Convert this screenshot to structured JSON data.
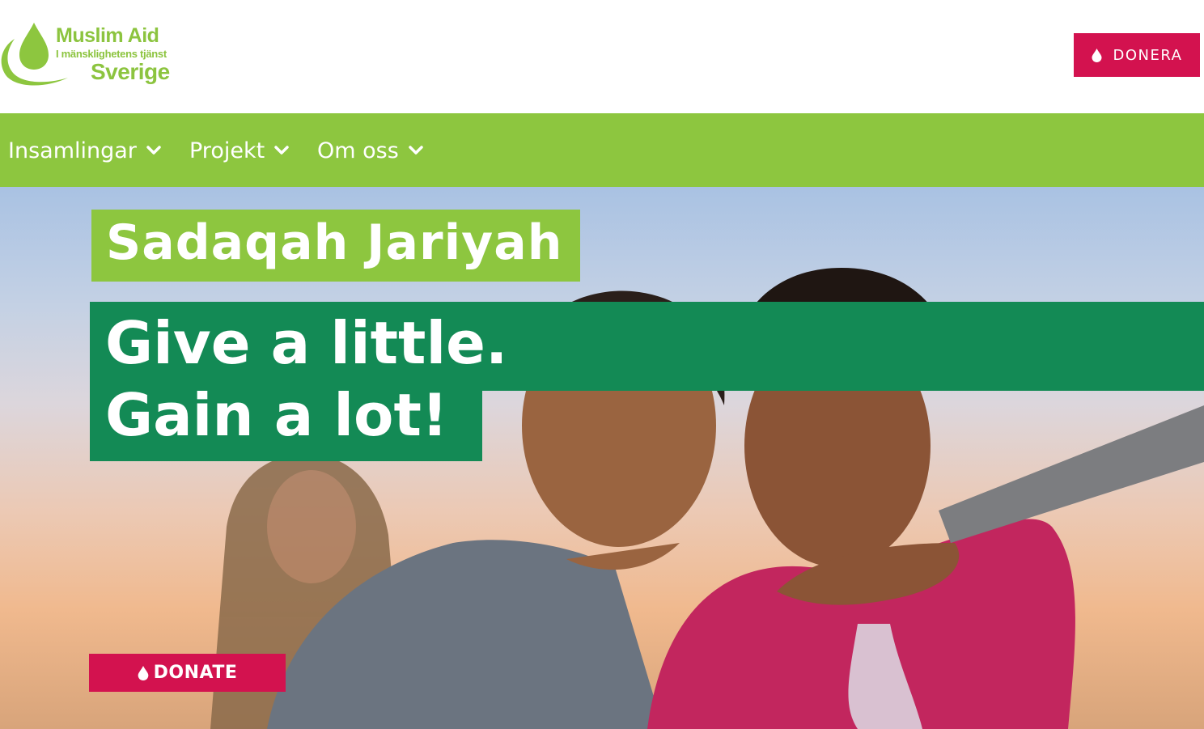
{
  "header": {
    "logo": {
      "line1": "Muslim Aid",
      "line2": "I mänsklighetens tjänst",
      "line3": "Sverige"
    },
    "donate_button": {
      "label": "DONERA",
      "icon": "drop-icon"
    }
  },
  "nav": {
    "items": [
      {
        "label": "Insamlingar",
        "icon": "chevron-down-icon"
      },
      {
        "label": "Projekt",
        "icon": "chevron-down-icon"
      },
      {
        "label": "Om oss",
        "icon": "chevron-down-icon"
      }
    ]
  },
  "hero": {
    "tag": "Sadaqah Jariyah",
    "headline_line1": "Give a little.",
    "headline_line2": "Gain a lot!",
    "donate_button": {
      "label": "DONATE",
      "icon": "drop-icon"
    }
  },
  "colors": {
    "brand_green": "#8dc63f",
    "dark_green": "#138a55",
    "accent_pink": "#d3124f"
  }
}
